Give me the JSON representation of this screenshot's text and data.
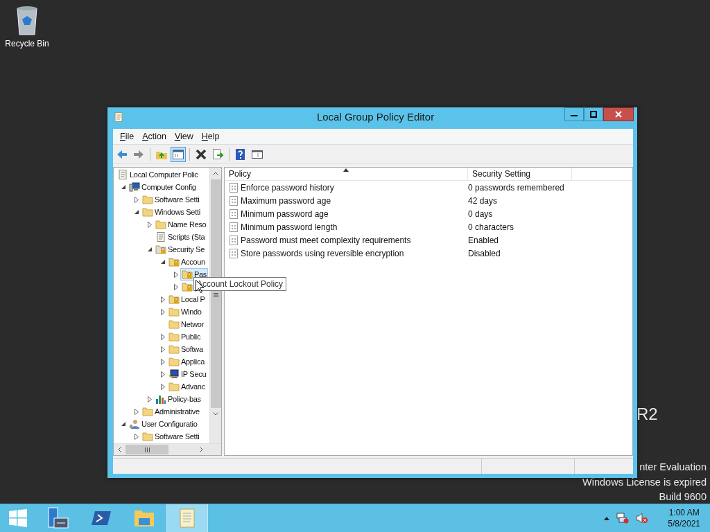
{
  "desktop": {
    "icons": [
      {
        "label": "Recycle Bin"
      }
    ],
    "watermark": {
      "edition": "R2",
      "lines": [
        "nter Evaluation",
        "Windows License is expired",
        "Build 9600"
      ]
    }
  },
  "window": {
    "title": "Local Group Policy Editor",
    "menu": [
      {
        "key": "F",
        "rest": "ile"
      },
      {
        "key": "A",
        "rest": "ction"
      },
      {
        "key": "V",
        "rest": "iew"
      },
      {
        "key": "H",
        "rest": "elp"
      }
    ],
    "toolbar": [
      {
        "kind": "back",
        "pressed": false
      },
      {
        "kind": "forward",
        "pressed": false
      },
      {
        "kind": "separator"
      },
      {
        "kind": "up",
        "pressed": false
      },
      {
        "kind": "tree-toggle",
        "pressed": true
      },
      {
        "kind": "separator"
      },
      {
        "kind": "delete",
        "pressed": false
      },
      {
        "kind": "export",
        "pressed": false
      },
      {
        "kind": "separator"
      },
      {
        "kind": "help",
        "pressed": false
      },
      {
        "kind": "view",
        "pressed": false
      }
    ],
    "tree": {
      "items": [
        {
          "label": "Local Computer Polic",
          "kind": "policy",
          "selected": false,
          "children": [
            {
              "label": "Computer Config",
              "kind": "computer",
              "expanded": true,
              "selected": false,
              "children": [
                {
                  "label": "Software Setti",
                  "kind": "folder",
                  "expanded": false,
                  "selected": false
                },
                {
                  "label": "Windows Setti",
                  "kind": "folder",
                  "expanded": true,
                  "selected": false,
                  "children": [
                    {
                      "label": "Name Reso",
                      "kind": "folder",
                      "expanded": false,
                      "selected": false
                    },
                    {
                      "label": "Scripts (Sta",
                      "kind": "script",
                      "selected": false
                    },
                    {
                      "label": "Security Se",
                      "kind": "security",
                      "expanded": true,
                      "selected": false,
                      "children": [
                        {
                          "label": "Accoun",
                          "kind": "locked-folder",
                          "expanded": true,
                          "selected": false,
                          "children": [
                            {
                              "label": "Pas",
                              "kind": "locked-folder",
                              "expanded": false,
                              "selected": true
                            },
                            {
                              "kind": "locked-folder",
                              "expanded": false,
                              "selected": false
                            }
                          ]
                        },
                        {
                          "label": "Local P",
                          "kind": "locked-folder",
                          "expanded": false,
                          "selected": false
                        },
                        {
                          "label": "Windo",
                          "kind": "folder",
                          "expanded": false,
                          "selected": false
                        },
                        {
                          "label": "Networ",
                          "kind": "folder",
                          "selected": false
                        },
                        {
                          "label": "Public",
                          "kind": "folder",
                          "expanded": false,
                          "selected": false
                        },
                        {
                          "label": "Softwa",
                          "kind": "folder",
                          "expanded": false,
                          "selected": false
                        },
                        {
                          "label": "Applica",
                          "kind": "folder",
                          "expanded": false,
                          "selected": false
                        },
                        {
                          "label": "IP Secu",
                          "kind": "ipsec",
                          "expanded": false,
                          "selected": false
                        },
                        {
                          "label": "Advanc",
                          "kind": "folder",
                          "expanded": false,
                          "selected": false
                        }
                      ]
                    },
                    {
                      "label": "Policy-bas",
                      "kind": "chart",
                      "expanded": false,
                      "selected": false
                    }
                  ]
                },
                {
                  "label": "Administrative",
                  "kind": "folder",
                  "expanded": false,
                  "selected": false
                }
              ]
            },
            {
              "label": "User Configuratio",
              "kind": "user",
              "expanded": true,
              "selected": false,
              "children": [
                {
                  "label": "Software Setti",
                  "kind": "folder",
                  "expanded": false,
                  "selected": false
                }
              ]
            }
          ]
        }
      ],
      "tooltip": "Account Lockout Policy"
    },
    "list": {
      "columns": [
        {
          "label": "Policy",
          "sorted": true
        },
        {
          "label": "Security Setting",
          "sorted": false
        }
      ],
      "rows": [
        {
          "policy": "Enforce password history",
          "setting": "0 passwords remembered"
        },
        {
          "policy": "Maximum password age",
          "setting": "42 days"
        },
        {
          "policy": "Minimum password age",
          "setting": "0 days"
        },
        {
          "policy": "Minimum password length",
          "setting": "0 characters"
        },
        {
          "policy": "Password must meet complexity requirements",
          "setting": "Enabled"
        },
        {
          "policy": "Store passwords using reversible encryption",
          "setting": "Disabled"
        }
      ]
    }
  },
  "taskbar": {
    "apps": [
      {
        "kind": "server-manager",
        "active": false
      },
      {
        "kind": "powershell",
        "active": false
      },
      {
        "kind": "file-explorer",
        "active": false
      },
      {
        "kind": "policy-editor",
        "active": true
      }
    ],
    "tray": {
      "time": "1:00 AM",
      "date": "5/8/2021"
    }
  }
}
